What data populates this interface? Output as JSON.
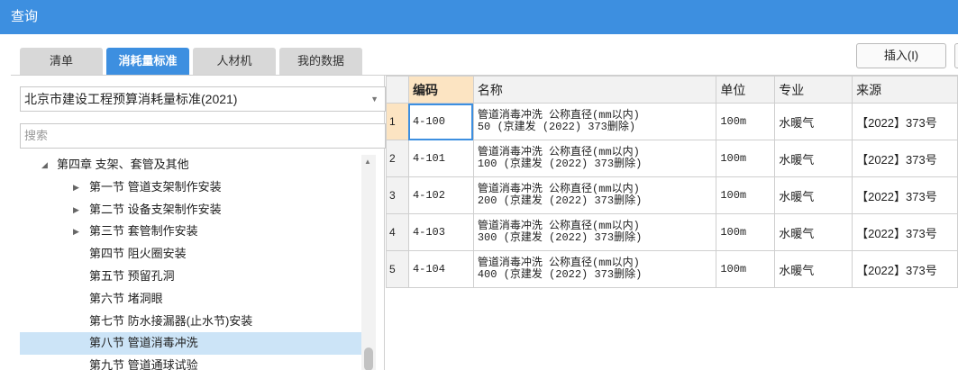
{
  "window": {
    "title": "查询"
  },
  "tabs": [
    {
      "label": "清单",
      "active": false
    },
    {
      "label": "消耗量标准",
      "active": true
    },
    {
      "label": "人材机",
      "active": false
    },
    {
      "label": "我的数据",
      "active": false
    }
  ],
  "toolbar": {
    "insert_label": "插入(I)"
  },
  "left": {
    "standard_select": {
      "value": "北京市建设工程预算消耗量标准(2021)"
    },
    "search": {
      "placeholder": "搜索"
    },
    "tree": [
      {
        "label": "第四章 支架、套管及其他",
        "level": 0,
        "caret": "◢"
      },
      {
        "label": "第一节 管道支架制作安装",
        "level": 1,
        "caret": "▶"
      },
      {
        "label": "第二节 设备支架制作安装",
        "level": 1,
        "caret": "▶"
      },
      {
        "label": "第三节 套管制作安装",
        "level": 1,
        "caret": "▶"
      },
      {
        "label": "第四节 阻火圈安装",
        "level": 1,
        "caret": ""
      },
      {
        "label": "第五节 预留孔洞",
        "level": 1,
        "caret": ""
      },
      {
        "label": "第六节 堵洞眼",
        "level": 1,
        "caret": ""
      },
      {
        "label": "第七节 防水接漏器(止水节)安装",
        "level": 1,
        "caret": ""
      },
      {
        "label": "第八节 管道消毒冲洗",
        "level": 1,
        "caret": "",
        "selected": true
      },
      {
        "label": "第九节 管道通球试验",
        "level": 1,
        "caret": ""
      }
    ]
  },
  "grid": {
    "columns": [
      "",
      "编码",
      "名称",
      "单位",
      "专业",
      "来源"
    ],
    "rows": [
      {
        "no": "1",
        "code": "4-100",
        "name_line1": "管道消毒冲洗 公称直径(mm以内)",
        "name_line2": "50 (京建发 (2022) 373删除)",
        "unit": "100m",
        "major": "水暖气",
        "source": "【2022】373号"
      },
      {
        "no": "2",
        "code": "4-101",
        "name_line1": "管道消毒冲洗 公称直径(mm以内)",
        "name_line2": "100 (京建发 (2022) 373删除)",
        "unit": "100m",
        "major": "水暖气",
        "source": "【2022】373号"
      },
      {
        "no": "3",
        "code": "4-102",
        "name_line1": "管道消毒冲洗 公称直径(mm以内)",
        "name_line2": "200 (京建发 (2022) 373删除)",
        "unit": "100m",
        "major": "水暖气",
        "source": "【2022】373号"
      },
      {
        "no": "4",
        "code": "4-103",
        "name_line1": "管道消毒冲洗 公称直径(mm以内)",
        "name_line2": "300 (京建发 (2022) 373删除)",
        "unit": "100m",
        "major": "水暖气",
        "source": "【2022】373号"
      },
      {
        "no": "5",
        "code": "4-104",
        "name_line1": "管道消毒冲洗 公称直径(mm以内)",
        "name_line2": "400 (京建发 (2022) 373删除)",
        "unit": "100m",
        "major": "水暖气",
        "source": "【2022】373号"
      }
    ]
  },
  "colors": {
    "accent": "#3d8fe0",
    "header_highlight": "#fce4c2",
    "selection": "#cce4f7"
  }
}
